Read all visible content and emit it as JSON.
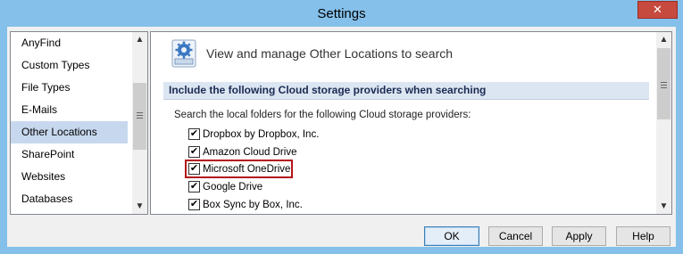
{
  "window": {
    "title": "Settings",
    "close_glyph": "✕"
  },
  "nav": {
    "items": [
      {
        "label": "AnyFind",
        "selected": false
      },
      {
        "label": "Custom Types",
        "selected": false
      },
      {
        "label": "File Types",
        "selected": false
      },
      {
        "label": "E-Mails",
        "selected": false
      },
      {
        "label": "Other Locations",
        "selected": true
      },
      {
        "label": "SharePoint",
        "selected": false
      },
      {
        "label": "Websites",
        "selected": false
      },
      {
        "label": "Databases",
        "selected": false
      }
    ]
  },
  "panel": {
    "header_icon": "gear-settings-icon",
    "header_text": "View and manage Other Locations to search",
    "section_title": "Include the following Cloud storage providers when searching",
    "intro": "Search the local folders for the following Cloud storage providers:",
    "options": [
      {
        "label": "Dropbox by Dropbox, Inc.",
        "checked": true
      },
      {
        "label": "Amazon Cloud Drive",
        "checked": true
      },
      {
        "label": "Microsoft OneDrive",
        "checked": true
      },
      {
        "label": "Google Drive",
        "checked": true
      },
      {
        "label": "Box Sync by Box, Inc.",
        "checked": true
      }
    ],
    "highlighted_option": "Microsoft OneDrive",
    "highlight_color": "#b3151a"
  },
  "buttons": {
    "ok": "OK",
    "cancel": "Cancel",
    "apply": "Apply",
    "help": "Help"
  },
  "colors": {
    "title_bar": "#84c0ea",
    "close": "#c74a3e",
    "selection": "#c7d8ee",
    "section": "#dce6f2"
  }
}
